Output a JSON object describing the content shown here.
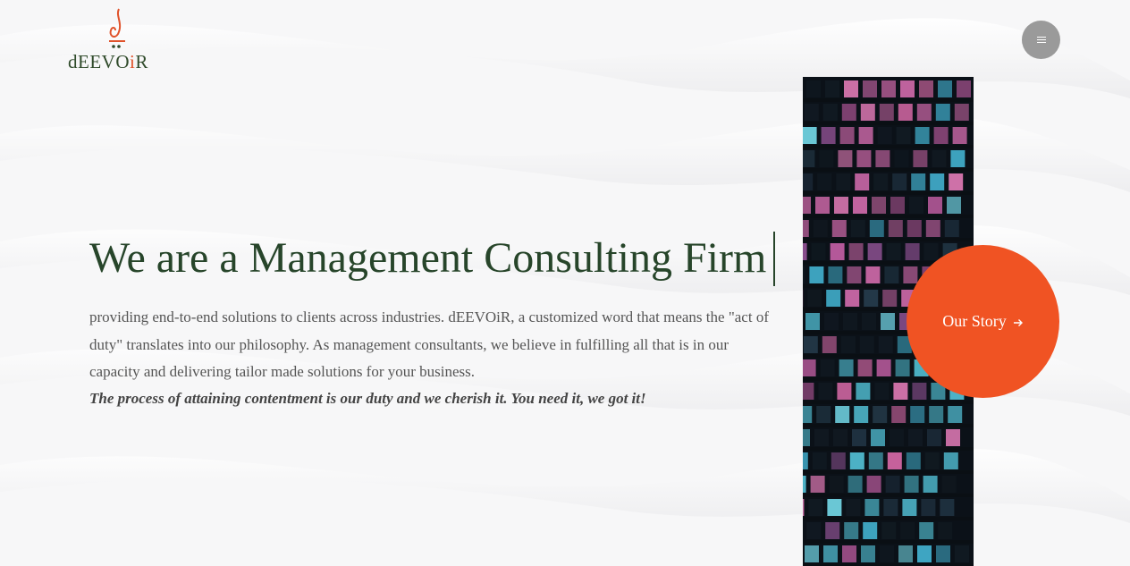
{
  "brand": {
    "logo_text_prefix": "dEEVO",
    "logo_text_accent": "i",
    "logo_text_suffix": "R",
    "logo_icon": "flame-icon",
    "accent_color": "#f05323",
    "text_color": "#27452a"
  },
  "nav": {
    "menu_icon": "hamburger-menu-icon"
  },
  "hero": {
    "title": "We are a Management Consulting Firm",
    "body": "providing end-to-end solutions to clients across industries. dEEVOiR, a customized word that means the \"act of duty\" translates into our philosophy. As management consultants, we believe in fulfilling all that is in our capacity and delivering tailor made solutions for your business.",
    "tagline": "The process of attaining contentment is our duty and we cherish it. You need it, we got it!"
  },
  "cta": {
    "label": "Our Story",
    "icon": "arrow-right-icon"
  },
  "media": {
    "image": "office-building-night-windows"
  }
}
